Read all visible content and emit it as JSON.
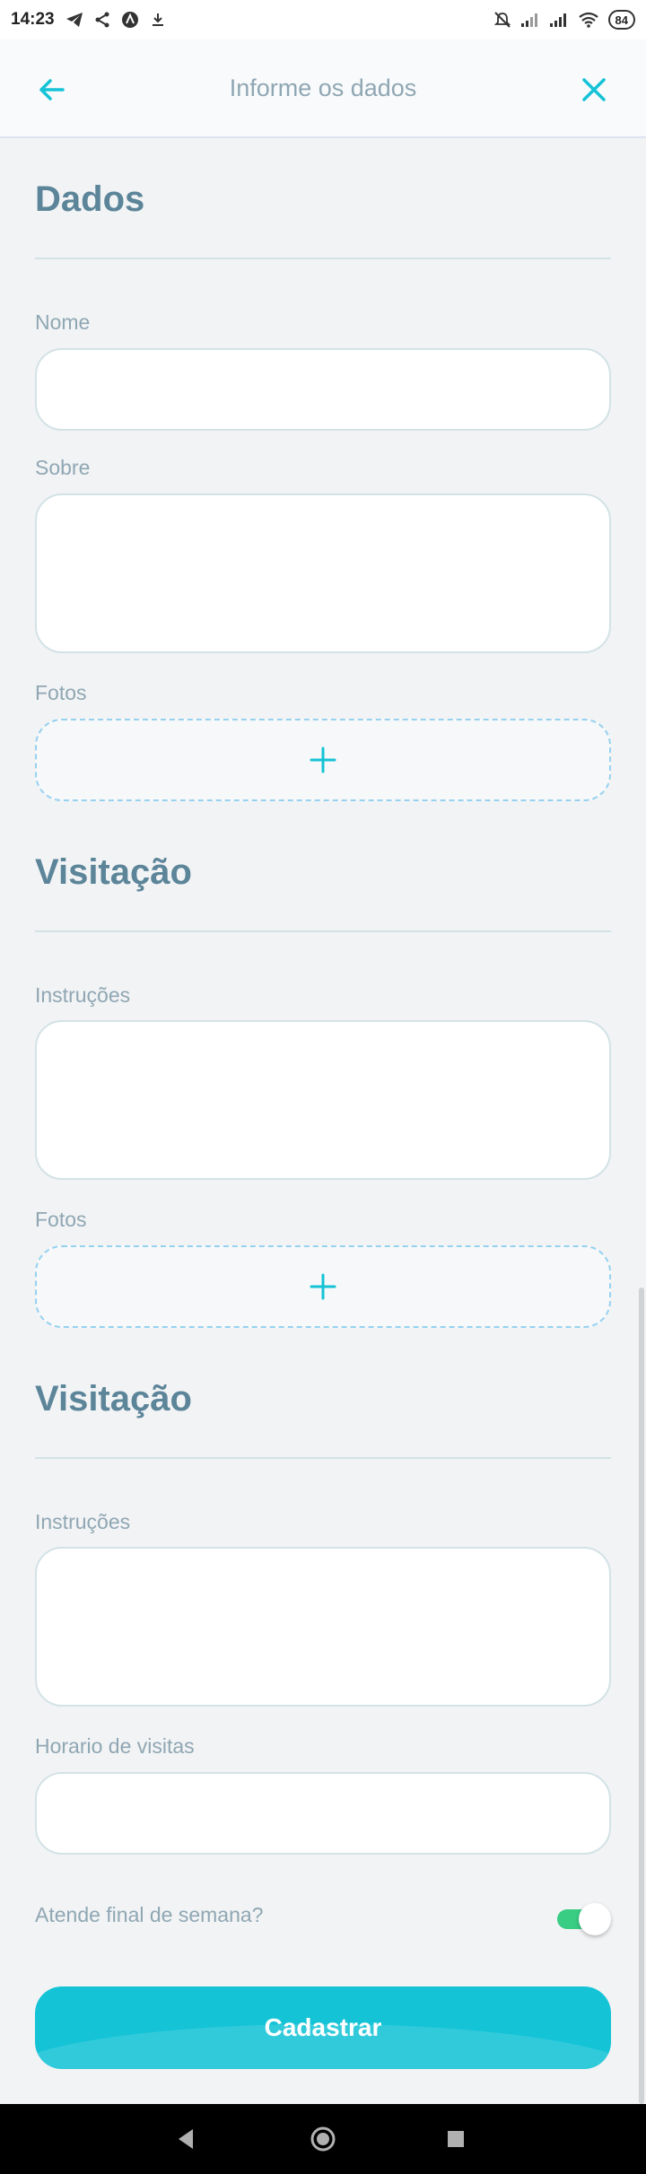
{
  "status_bar": {
    "time": "14:23",
    "battery": "84",
    "icons_left": [
      "telegram-icon",
      "share-icon",
      "vpn-icon",
      "download-icon"
    ],
    "icons_right": [
      "mute-icon",
      "signal-icon",
      "signal-icon",
      "wifi-icon",
      "battery-icon"
    ]
  },
  "header": {
    "title": "Informe os dados",
    "back_icon": "arrow-left-icon",
    "close_icon": "close-icon"
  },
  "sections": {
    "dados": {
      "title": "Dados",
      "nome_label": "Nome",
      "sobre_label": "Sobre",
      "fotos_label": "Fotos"
    },
    "visitacao1": {
      "title": "Visitação",
      "instrucoes_label": "Instruções",
      "fotos_label": "Fotos"
    },
    "visitacao2": {
      "title": "Visitação",
      "instrucoes_label": "Instruções",
      "horario_label": "Horario de visitas",
      "weekend_label": "Atende final de semana?",
      "weekend_value": true
    }
  },
  "submit_label": "Cadastrar",
  "colors": {
    "accent": "#15c3d6",
    "title": "#5c8599",
    "label": "#8fa7b3",
    "toggle_on": "#39cc83",
    "dashed_border": "#96d2f0"
  }
}
